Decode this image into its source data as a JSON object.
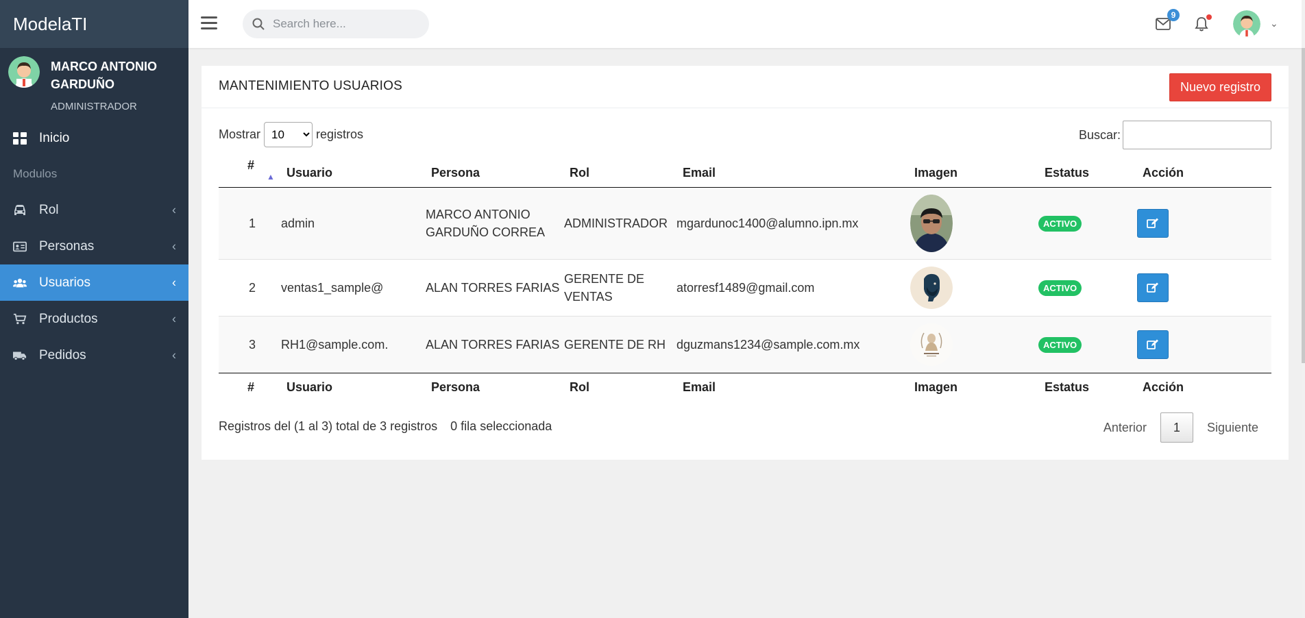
{
  "app": {
    "brand": "ModelaTI"
  },
  "user_panel": {
    "name": "MARCO ANTONIO GARDUÑO",
    "role": "ADMINISTRADOR"
  },
  "sidebar": {
    "home_label": "Inicio",
    "section_header": "Modulos",
    "items": [
      {
        "label": "Rol",
        "icon": "car-icon"
      },
      {
        "label": "Personas",
        "icon": "id-card-icon"
      },
      {
        "label": "Usuarios",
        "icon": "users-icon",
        "active": true
      },
      {
        "label": "Productos",
        "icon": "cart-icon"
      },
      {
        "label": "Pedidos",
        "icon": "truck-icon"
      }
    ]
  },
  "topbar": {
    "search_placeholder": "Search here...",
    "mail_badge": "9"
  },
  "card": {
    "title": "MANTENIMIENTO USUARIOS",
    "new_button": "Nuevo registro"
  },
  "datatable": {
    "length_label_before": "Mostrar",
    "length_value": "10",
    "length_label_after": "registros",
    "search_label": "Buscar:",
    "columns": [
      "#",
      "Usuario",
      "Persona",
      "Rol",
      "Email",
      "Imagen",
      "Estatus",
      "Acción"
    ],
    "rows": [
      {
        "num": "1",
        "usuario": "admin",
        "persona": "MARCO ANTONIO GARDUÑO CORREA",
        "rol": "ADMINISTRADOR",
        "email": "mgardunoc1400@alumno.ipn.mx",
        "estatus": "ACTIVO"
      },
      {
        "num": "2",
        "usuario": "ventas1_sample@",
        "persona": "ALAN TORRES FARIAS",
        "rol": "GERENTE DE VENTAS",
        "email": "atorresf1489@gmail.com",
        "estatus": "ACTIVO"
      },
      {
        "num": "3",
        "usuario": "RH1@sample.com.",
        "persona": "ALAN TORRES FARIAS",
        "rol": "GERENTE DE RH",
        "email": "dguzmans1234@sample.com.mx",
        "estatus": "ACTIVO"
      }
    ],
    "info": "Registros del (1 al 3) total de 3 registros",
    "selection_info": "0 fila seleccionada",
    "pager": {
      "prev": "Anterior",
      "page": "1",
      "next": "Siguiente"
    }
  },
  "colors": {
    "sidebar_bg": "#273444",
    "active": "#3c8fd7",
    "danger": "#e8453c",
    "success": "#22c164"
  }
}
